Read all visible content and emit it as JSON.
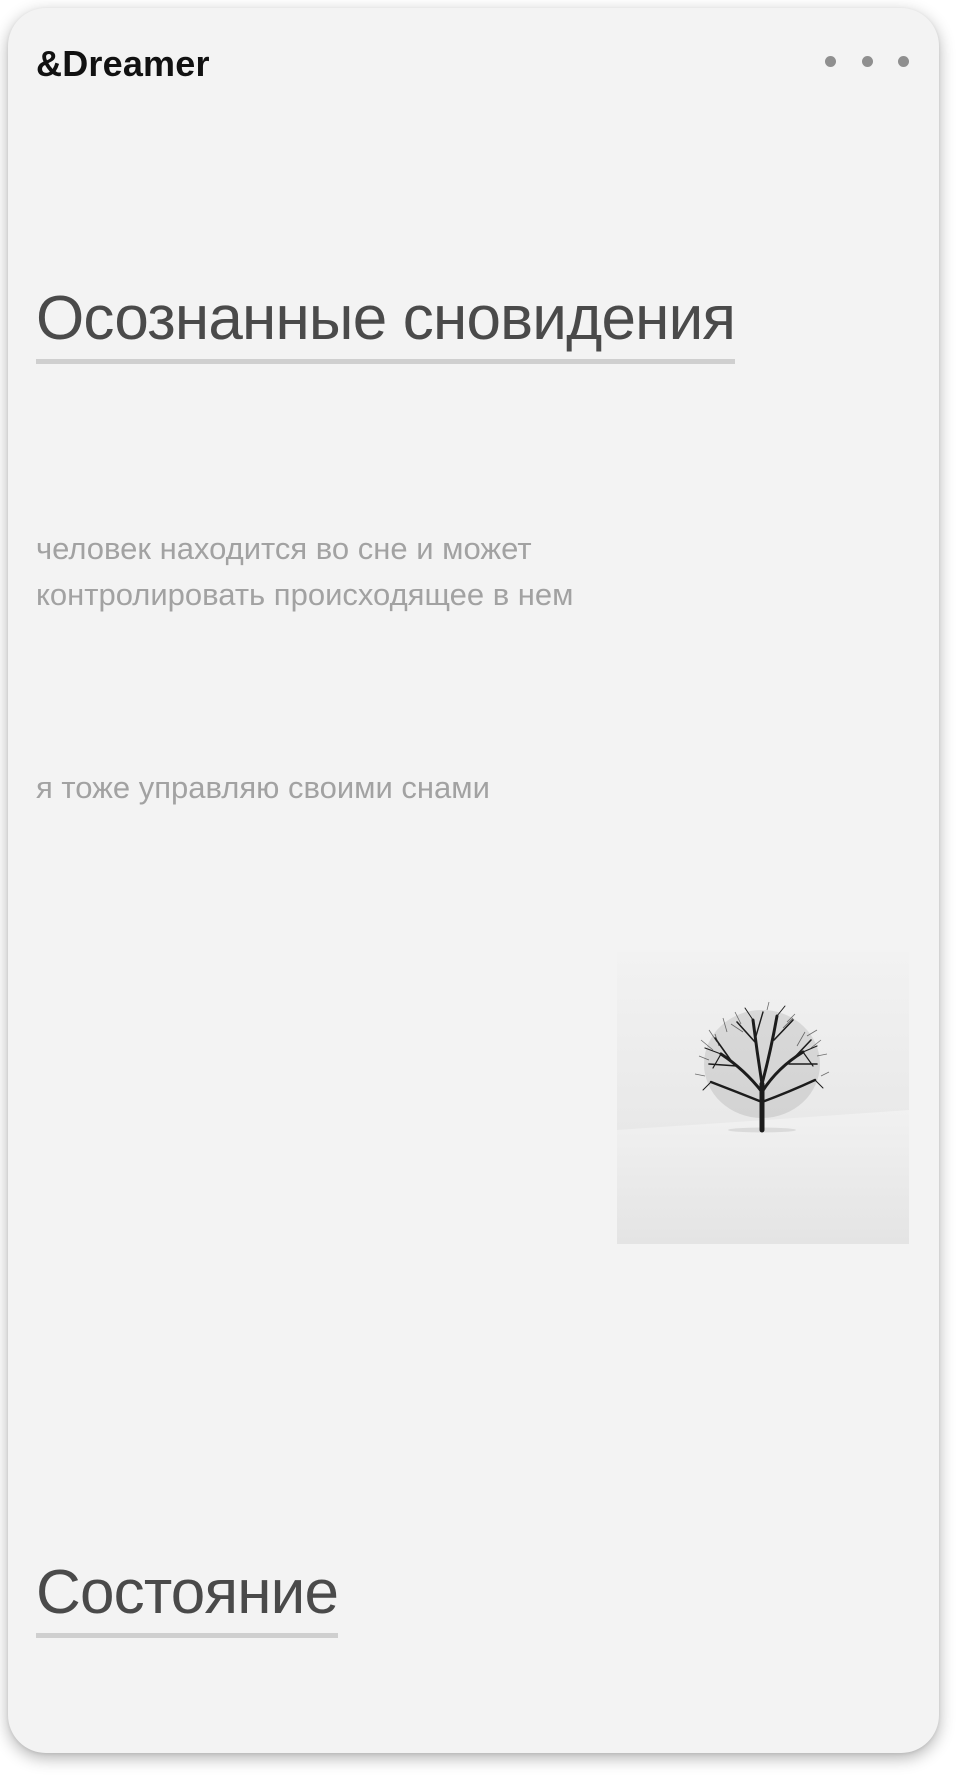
{
  "app": {
    "logo": "&Dreamer",
    "menu_icon": "more-horizontal-icon"
  },
  "main": {
    "title": "Осознанные сновидения",
    "description_lines": [
      "человек находится во сне и может",
      "контролировать происходящее в нем"
    ],
    "note": "я тоже управляю своими снами",
    "image": {
      "subject": "lone-tree-in-snow"
    },
    "section_title": "Состояние"
  },
  "colors": {
    "background": "#f3f3f3",
    "heading": "#4a4a4a",
    "body_text": "#a2a2a2",
    "underline": "#cfcfcf",
    "logo": "#111111"
  }
}
